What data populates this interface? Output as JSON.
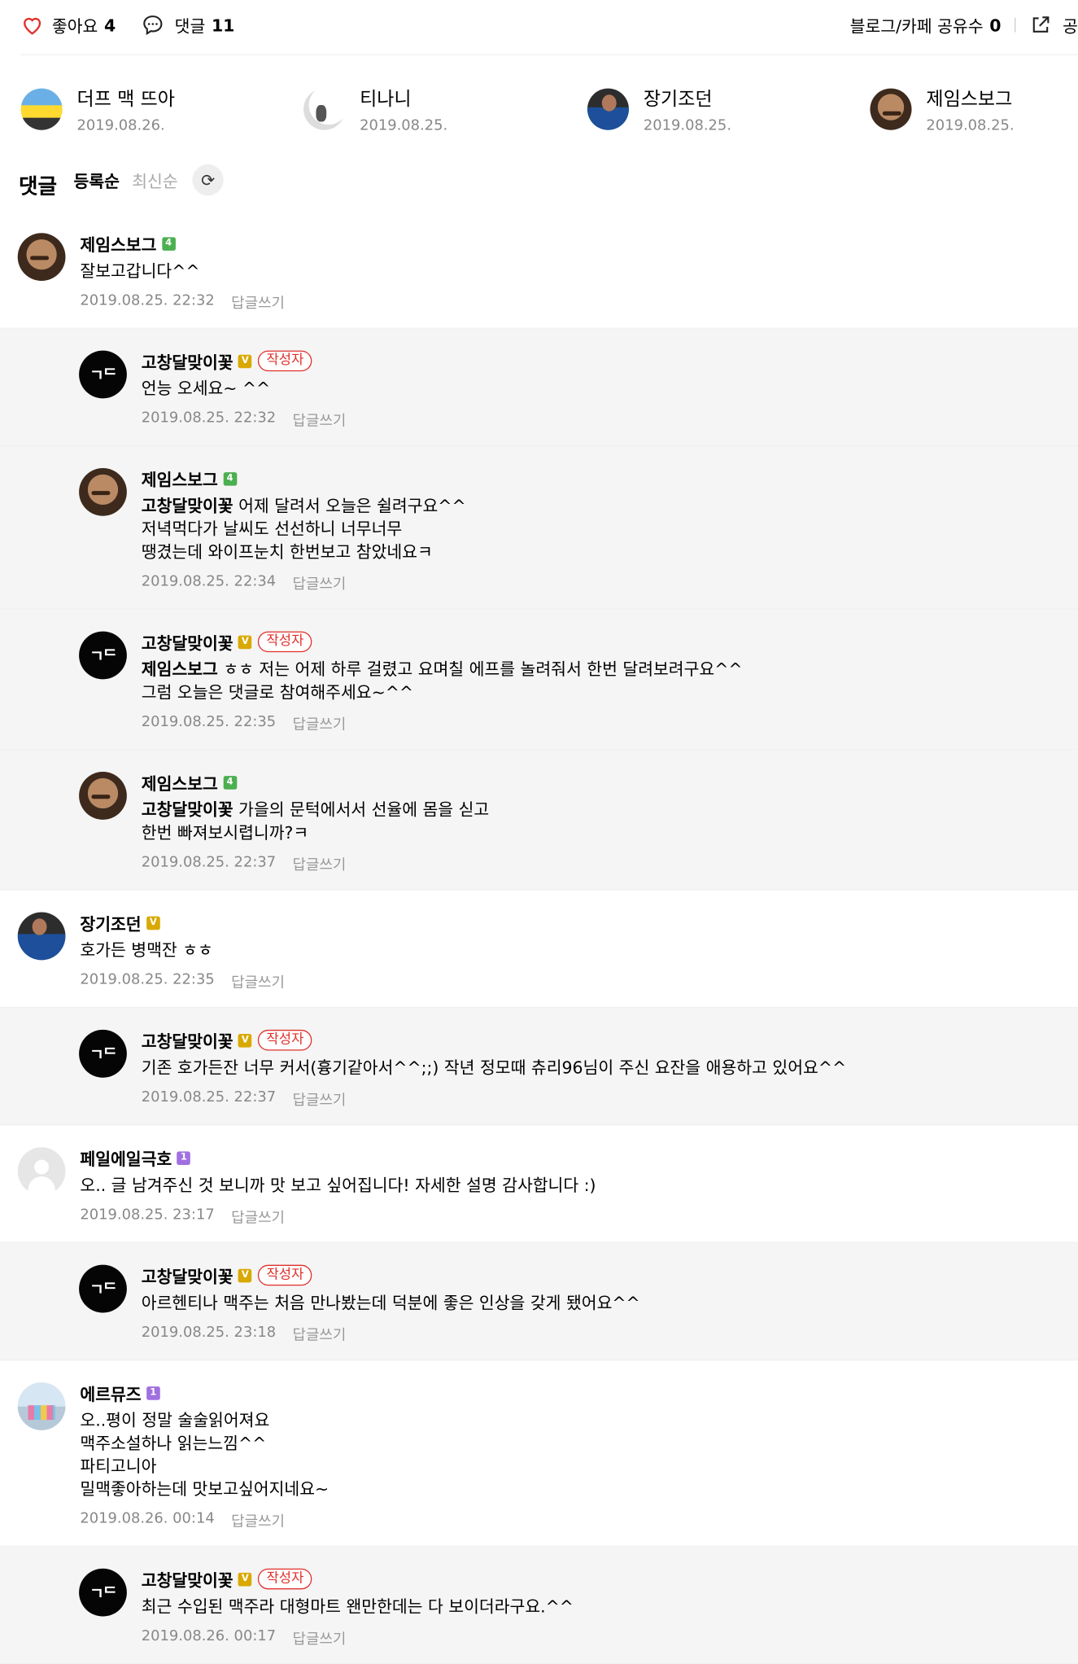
{
  "actions": {
    "like_label": "좋아요",
    "like_count": "4",
    "comment_label": "댓글",
    "comment_count": "11",
    "share_count_label": "블로그/카페 공유수",
    "share_count": "0",
    "share_label": "공"
  },
  "likers": [
    {
      "name": "더프 맥 뜨아",
      "date": "2019.08.26.",
      "avatar": "simpson-avatar"
    },
    {
      "name": "티나니",
      "date": "2019.08.25.",
      "avatar": "tina-avatar"
    },
    {
      "name": "장기조던",
      "date": "2019.08.25.",
      "avatar": "player-avatar"
    },
    {
      "name": "제임스보그",
      "date": "2019.08.25.",
      "avatar": "face-avatar"
    }
  ],
  "comments_header": {
    "title": "댓글",
    "sort_registered": "등록순",
    "sort_latest": "최신순",
    "refresh_icon": "refresh-icon"
  },
  "reply_label": "답글쓰기",
  "writer_badge": "작성자",
  "comments": [
    {
      "author": "제임스보그",
      "badge": "4",
      "badge_color": "#4caf50",
      "text": "잘보고갑니다^^",
      "mention": "",
      "time": "2019.08.25. 22:32",
      "reply": false,
      "writer": false,
      "avatar": "face"
    },
    {
      "author": "고창달맞이꽃",
      "badge": "V",
      "badge_color": "#d9a900",
      "text": "언능 오세요~ ^^",
      "mention": "",
      "time": "2019.08.25. 22:32",
      "reply": true,
      "writer": true,
      "avatar": "black",
      "avatar_text": "ㄱᄃ"
    },
    {
      "author": "제임스보그",
      "badge": "4",
      "badge_color": "#4caf50",
      "mention": "고창달맞이꽃",
      "text": " 어제 달려서 오늘은 쉴려구요^^\n저녁먹다가 날씨도 선선하니 너무너무\n땡겼는데 와이프눈치 한번보고 참았네요ㅋ",
      "time": "2019.08.25. 22:34",
      "reply": true,
      "writer": false,
      "avatar": "face"
    },
    {
      "author": "고창달맞이꽃",
      "badge": "V",
      "badge_color": "#d9a900",
      "mention": "제임스보그",
      "text": " ㅎㅎ 저는 어제 하루 걸렸고 요며칠 에프를 놀려줘서 한번 달려보려구요^^\n그럼 오늘은 댓글로 참여해주세요~^^",
      "time": "2019.08.25. 22:35",
      "reply": true,
      "writer": true,
      "avatar": "black",
      "avatar_text": "ㄱᄃ"
    },
    {
      "author": "제임스보그",
      "badge": "4",
      "badge_color": "#4caf50",
      "mention": "고창달맞이꽃",
      "text": " 가을의 문턱에서서 선율에 몸을 싣고\n한번 빠져보시렵니까?ㅋ",
      "time": "2019.08.25. 22:37",
      "reply": true,
      "writer": false,
      "avatar": "face"
    },
    {
      "author": "장기조던",
      "badge": "V",
      "badge_color": "#d9a900",
      "mention": "",
      "text": "호가든 병맥잔 ㅎㅎ",
      "time": "2019.08.25. 22:35",
      "reply": false,
      "writer": false,
      "avatar": "player"
    },
    {
      "author": "고창달맞이꽃",
      "badge": "V",
      "badge_color": "#d9a900",
      "mention": "",
      "text": "기존 호가든잔 너무 커서(흉기같아서^^;;) 작년 정모때 츄리96님이 주신 요잔을 애용하고 있어요^^",
      "time": "2019.08.25. 22:37",
      "reply": true,
      "writer": true,
      "avatar": "black",
      "avatar_text": "ㄱᄃ"
    },
    {
      "author": "페일에일극호",
      "badge": "1",
      "badge_color": "#a070e0",
      "mention": "",
      "text": "오.. 글 남겨주신 것 보니까 맛 보고 싶어집니다! 자세한 설명 감사합니다 :)",
      "time": "2019.08.25. 23:17",
      "reply": false,
      "writer": false,
      "avatar": "gray"
    },
    {
      "author": "고창달맞이꽃",
      "badge": "V",
      "badge_color": "#d9a900",
      "mention": "",
      "text": "아르헨티나 맥주는 처음 만나봤는데 덕분에 좋은 인상을 갖게 됐어요^^",
      "time": "2019.08.25. 23:18",
      "reply": true,
      "writer": true,
      "avatar": "black",
      "avatar_text": "ㄱᄃ"
    },
    {
      "author": "에르뮤즈",
      "badge": "1",
      "badge_color": "#a070e0",
      "mention": "",
      "text": "오..평이 정말 술술읽어져요\n맥주소설하나 읽는느낌^^\n파티고니아\n밀맥좋아하는데 맛보고싶어지네요~",
      "time": "2019.08.26. 00:14",
      "reply": false,
      "writer": false,
      "avatar": "errmuz"
    },
    {
      "author": "고창달맞이꽃",
      "badge": "V",
      "badge_color": "#d9a900",
      "mention": "",
      "text": "최근 수입된 맥주라 대형마트 왠만한데는 다 보이더라구요.^^",
      "time": "2019.08.26. 00:17",
      "reply": true,
      "writer": true,
      "avatar": "black",
      "avatar_text": "ㄱᄃ"
    }
  ]
}
